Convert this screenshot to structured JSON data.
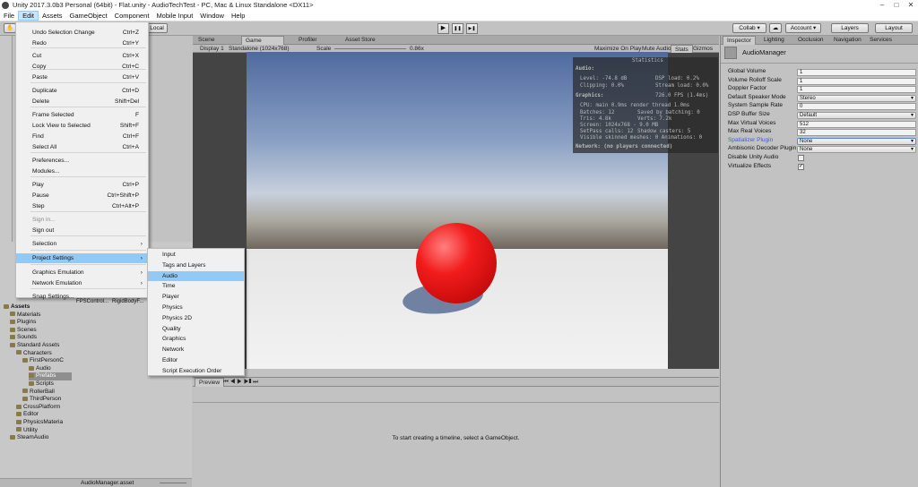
{
  "window": {
    "title": "Unity 2017.3.0b3 Personal (64bit) - Flat.unity - AudioTechTest - PC, Mac & Linux Standalone <DX11>",
    "min": "–",
    "max": "□",
    "close": "✕"
  },
  "menubar": [
    "File",
    "Edit",
    "Assets",
    "GameObject",
    "Component",
    "Mobile Input",
    "Window",
    "Help"
  ],
  "toolbar": {
    "local": "Local",
    "collab": "Collab ▾",
    "cloud": "☁",
    "account": "Account ▾",
    "layers": "Layers",
    "layout": "Layout",
    "play": "▶",
    "pause": "❚❚",
    "step": "▶❚"
  },
  "edit_menu": [
    {
      "label": "Undo Selection Change",
      "shortcut": "Ctrl+Z"
    },
    {
      "label": "Redo",
      "shortcut": "Ctrl+Y"
    },
    {
      "label": "Cut",
      "shortcut": "Ctrl+X"
    },
    {
      "label": "Copy",
      "shortcut": "Ctrl+C"
    },
    {
      "label": "Paste",
      "shortcut": "Ctrl+V"
    },
    {
      "label": "Duplicate",
      "shortcut": "Ctrl+D"
    },
    {
      "label": "Delete",
      "shortcut": "Shift+Del"
    },
    {
      "label": "Frame Selected",
      "shortcut": "F"
    },
    {
      "label": "Lock View to Selected",
      "shortcut": "Shift+F"
    },
    {
      "label": "Find",
      "shortcut": "Ctrl+F"
    },
    {
      "label": "Select All",
      "shortcut": "Ctrl+A"
    },
    {
      "label": "Preferences...",
      "shortcut": ""
    },
    {
      "label": "Modules...",
      "shortcut": ""
    },
    {
      "label": "Play",
      "shortcut": "Ctrl+P"
    },
    {
      "label": "Pause",
      "shortcut": "Ctrl+Shift+P"
    },
    {
      "label": "Step",
      "shortcut": "Ctrl+Alt+P"
    },
    {
      "label": "Sign in...",
      "shortcut": ""
    },
    {
      "label": "Sign out",
      "shortcut": ""
    },
    {
      "label": "Selection",
      "shortcut": ""
    },
    {
      "label": "Project Settings",
      "shortcut": ""
    },
    {
      "label": "Graphics Emulation",
      "shortcut": ""
    },
    {
      "label": "Network Emulation",
      "shortcut": ""
    },
    {
      "label": "Snap Settings...",
      "shortcut": ""
    }
  ],
  "submenu_arrow": "›",
  "project_settings_submenu": [
    "Input",
    "Tags and Layers",
    "Audio",
    "Time",
    "Player",
    "Physics",
    "Physics 2D",
    "Quality",
    "Graphics",
    "Network",
    "Editor",
    "Script Execution Order"
  ],
  "scene_tabs": {
    "scene": "Scene",
    "game": "Game",
    "profiler": "Profiler",
    "asset_store": "Asset Store"
  },
  "game_toolbar": {
    "display": "Display 1",
    "resolution": "Standalone (1024x768)",
    "scale_label": "Scale",
    "scale_value": "0.86x",
    "maximize": "Maximize On Play",
    "mute": "Mute Audio",
    "stats": "Stats",
    "gizmos": "Gizmos"
  },
  "stats": {
    "title": "Statistics",
    "audio_header": "Audio:",
    "level": "Level: -74.8 dB",
    "dsp": "DSP load: 0.2%",
    "clipping": "Clipping: 0.0%",
    "stream": "Stream load: 0.0%",
    "graphics_header": "Graphics:",
    "fps": "726.0 FPS (1.4ms)",
    "cpu": "CPU: main 0.9ms  render thread 1.0ms",
    "batches": "Batches: 12",
    "saved": "Saved by batching: 0",
    "tris": "Tris: 4.8k",
    "verts": "Verts: 7.2k",
    "screen": "Screen: 1024x768 - 9.0 MB",
    "setpass": "SetPass calls: 12",
    "shadow": "Shadow casters: 5",
    "skinned": "Visible skinned meshes: 0  Animations: 0",
    "network": "Network: (no players connected)"
  },
  "timeline": {
    "preview": "Preview",
    "message": "To start creating a timeline, select a GameObject."
  },
  "project": {
    "tree": [
      {
        "label": "Assets",
        "indent": 0,
        "bold": true
      },
      {
        "label": "Materials",
        "indent": 1
      },
      {
        "label": "Plugins",
        "indent": 1
      },
      {
        "label": "Scenes",
        "indent": 1
      },
      {
        "label": "Sounds",
        "indent": 1
      },
      {
        "label": "Standard Assets",
        "indent": 1
      },
      {
        "label": "Characters",
        "indent": 2
      },
      {
        "label": "FirstPersonC",
        "indent": 3
      },
      {
        "label": "Audio",
        "indent": 4
      },
      {
        "label": "Prefabs",
        "indent": 4,
        "selected": true
      },
      {
        "label": "Scripts",
        "indent": 4
      },
      {
        "label": "RollerBall",
        "indent": 3
      },
      {
        "label": "ThirdPerson",
        "indent": 3
      },
      {
        "label": "CrossPlatform",
        "indent": 2
      },
      {
        "label": "Editor",
        "indent": 2
      },
      {
        "label": "PhysicsMateria",
        "indent": 2
      },
      {
        "label": "Utility",
        "indent": 2
      },
      {
        "label": "SteamAudio",
        "indent": 1
      }
    ],
    "file1": "FPSControl...",
    "file2": "RigidBodyF...",
    "footer": "AudioManager.asset"
  },
  "inspector": {
    "tabs": [
      "Inspector",
      "Lighting",
      "Occlusion",
      "Navigation",
      "Services"
    ],
    "component": "AudioManager",
    "rows": [
      {
        "label": "Global Volume",
        "value": "1",
        "kind": "field"
      },
      {
        "label": "Volume Rolloff Scale",
        "value": "1",
        "kind": "field"
      },
      {
        "label": "Doppler Factor",
        "value": "1",
        "kind": "field"
      },
      {
        "label": "Default Speaker Mode",
        "value": "Stereo",
        "kind": "dropdown"
      },
      {
        "label": "System Sample Rate",
        "value": "0",
        "kind": "field"
      },
      {
        "label": "DSP Buffer Size",
        "value": "Default",
        "kind": "dropdown"
      },
      {
        "label": "Max Virtual Voices",
        "value": "512",
        "kind": "field"
      },
      {
        "label": "Max Real Voices",
        "value": "32",
        "kind": "field"
      },
      {
        "label": "Spatializer Plugin",
        "value": "None",
        "kind": "dropdown",
        "highlight": true
      },
      {
        "label": "Ambisonic Decoder Plugin",
        "value": "None",
        "kind": "dropdown"
      },
      {
        "label": "Disable Unity Audio",
        "value": "",
        "kind": "check"
      },
      {
        "label": "Virtualize Effects",
        "value": "✓",
        "kind": "check"
      }
    ]
  },
  "colors": {
    "accent": "#91c9f7",
    "editor_bg": "#c2c2c2",
    "sphere": "#e51b1b"
  }
}
